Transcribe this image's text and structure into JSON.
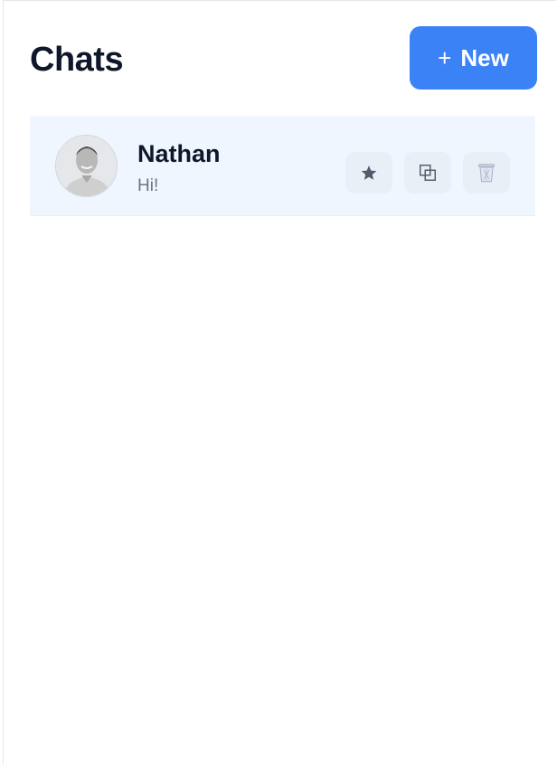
{
  "header": {
    "title": "Chats",
    "new_button": {
      "icon": "plus-icon",
      "plus_glyph": "+",
      "label": "New"
    }
  },
  "chats": [
    {
      "name": "Nathan",
      "preview": "Hi!",
      "avatar": "avatar-photo",
      "actions": [
        {
          "name": "star-button",
          "icon": "star-icon"
        },
        {
          "name": "duplicate-button",
          "icon": "copy-icon"
        },
        {
          "name": "delete-button",
          "icon": "trash-icon"
        }
      ]
    }
  ],
  "colors": {
    "accent": "#3b82f6",
    "selected_row": "#eff6ff",
    "title_text": "#0f172a",
    "muted_text": "#6b7280"
  }
}
